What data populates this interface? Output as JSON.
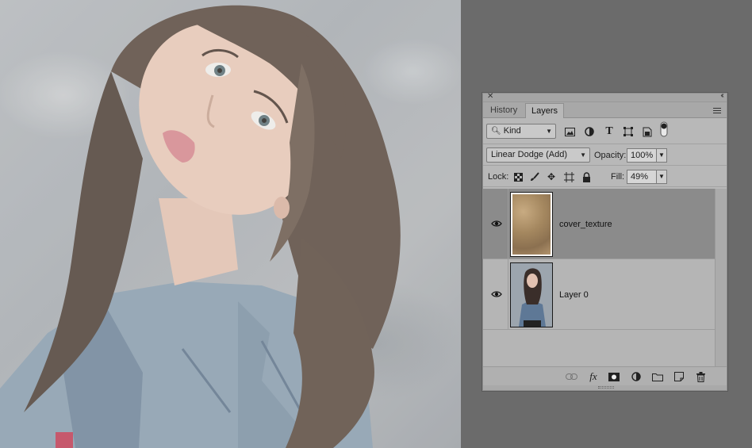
{
  "panel": {
    "tabs": [
      "History",
      "Layers"
    ],
    "filter": {
      "kind_label": "Kind"
    },
    "blend_mode": "Linear Dodge (Add)",
    "opacity_label": "Opacity:",
    "opacity_value": "100%",
    "lock_label": "Lock:",
    "fill_label": "Fill:",
    "fill_value": "49%",
    "layers": [
      {
        "name": "cover_texture",
        "visible": true,
        "selected": true,
        "thumb": "texture"
      },
      {
        "name": "Layer 0",
        "visible": true,
        "selected": false,
        "thumb": "photo"
      }
    ],
    "bottom_icons": [
      "link-icon",
      "fx-icon",
      "mask-icon",
      "adjustment-icon",
      "folder-icon",
      "new-layer-icon",
      "trash-icon"
    ]
  },
  "colors": {
    "panel_bg": "#b8b8b8",
    "selected_layer": "#8b8b8b",
    "workspace": "#6b6b6b"
  }
}
